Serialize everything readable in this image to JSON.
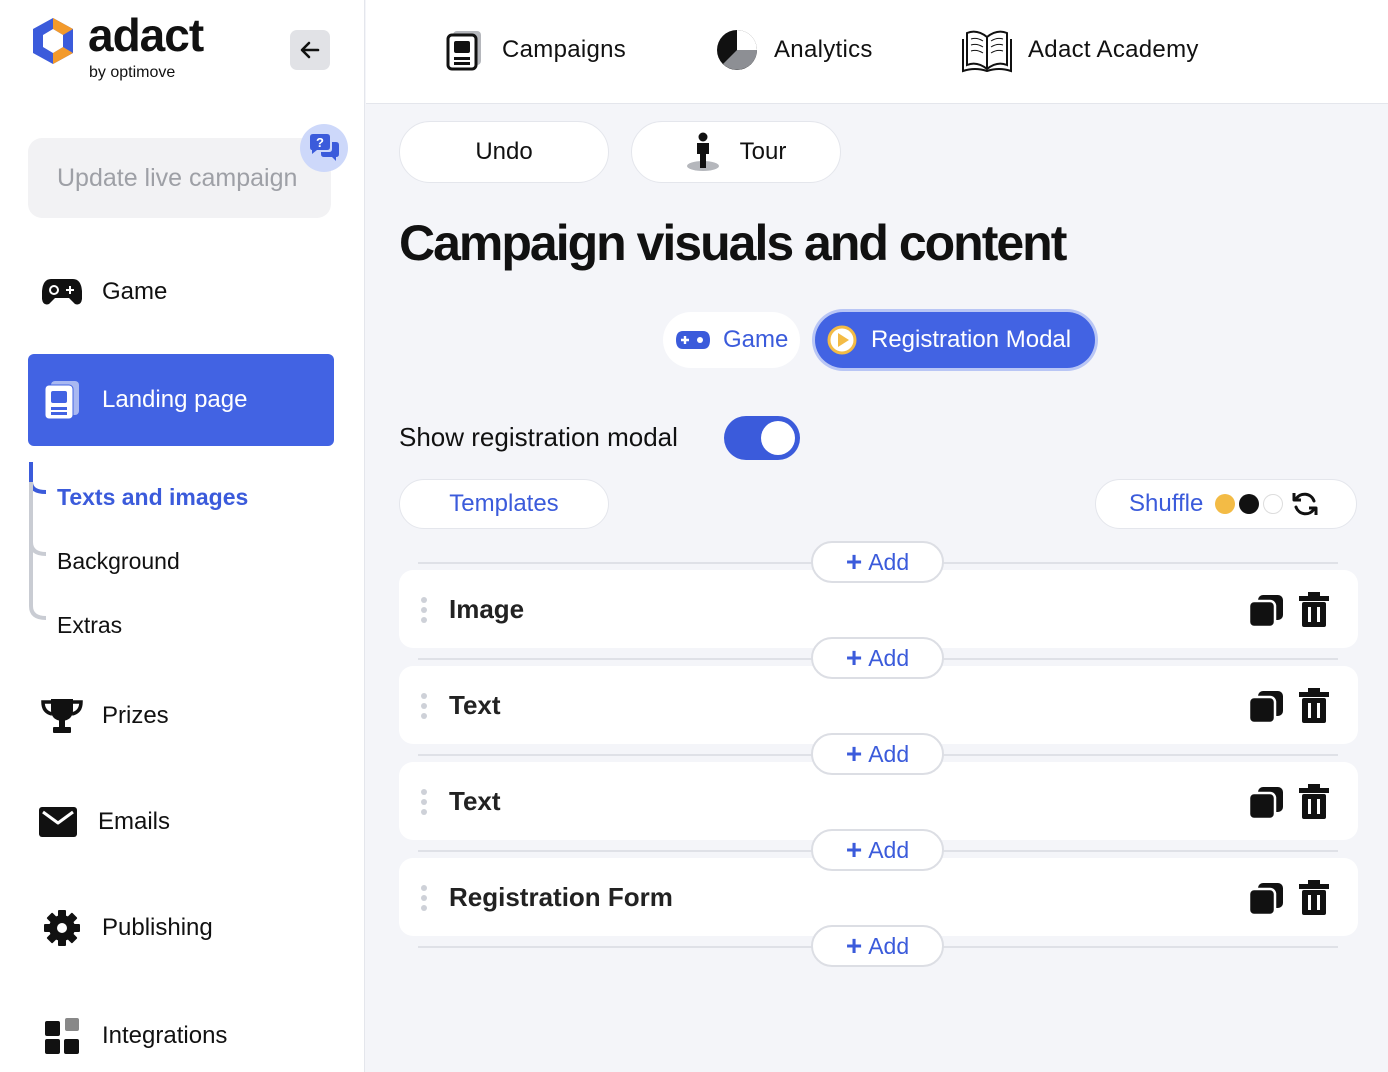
{
  "brand": {
    "name": "adact",
    "sub": "by optimove"
  },
  "sidebar": {
    "update_button": "Update live campaign",
    "items": [
      {
        "label": "Game"
      },
      {
        "label": "Landing page"
      },
      {
        "label": "Prizes"
      },
      {
        "label": "Emails"
      },
      {
        "label": "Publishing"
      },
      {
        "label": "Integrations"
      }
    ],
    "sub_items": [
      {
        "label": "Texts and images"
      },
      {
        "label": "Background"
      },
      {
        "label": "Extras"
      }
    ]
  },
  "topnav": {
    "items": [
      {
        "label": "Campaigns"
      },
      {
        "label": "Analytics"
      },
      {
        "label": "Adact Academy"
      }
    ]
  },
  "toolbar": {
    "undo": "Undo",
    "tour": "Tour"
  },
  "main": {
    "title": "Campaign visuals and content",
    "tabs": [
      {
        "label": "Game"
      },
      {
        "label": "Registration Modal"
      }
    ],
    "toggle": {
      "label": "Show registration modal",
      "on": true
    },
    "templates": "Templates",
    "shuffle": "Shuffle",
    "add_label": "Add",
    "blocks": [
      {
        "title": "Image"
      },
      {
        "title": "Text"
      },
      {
        "title": "Text"
      },
      {
        "title": "Registration Form"
      }
    ]
  },
  "colors": {
    "accent": "#4263e3",
    "accent_text": "#3b5bdb",
    "shuffle_dots": [
      "#f3bb45",
      "#111111",
      "#ffffff"
    ]
  }
}
